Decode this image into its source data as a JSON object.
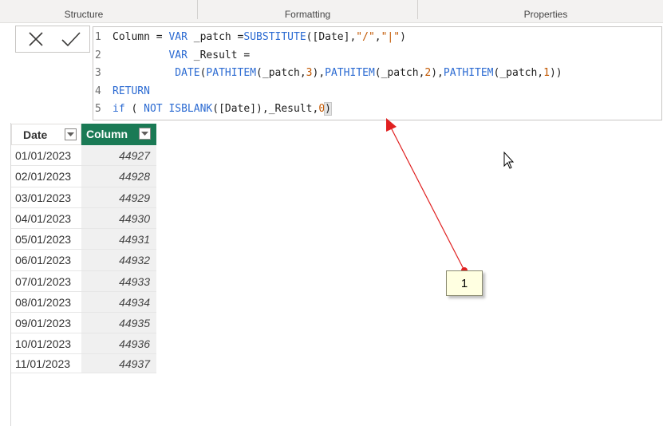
{
  "ribbon": {
    "tabs": [
      {
        "label": "Structure"
      },
      {
        "label": "Formatting"
      },
      {
        "label": "Properties"
      }
    ]
  },
  "formula_bar": {
    "cancel_icon": "close-icon",
    "commit_icon": "checkmark-icon",
    "lines": [
      {
        "num": "1",
        "parts": [
          {
            "t": "Column = ",
            "c": "t"
          },
          {
            "t": "VAR",
            "c": "k"
          },
          {
            "t": " _patch =",
            "c": "t"
          },
          {
            "t": "SUBSTITUTE",
            "c": "k"
          },
          {
            "t": "([Date],",
            "c": "t"
          },
          {
            "t": "\"/\"",
            "c": "s"
          },
          {
            "t": ",",
            "c": "t"
          },
          {
            "t": "\"|\"",
            "c": "s"
          },
          {
            "t": ")",
            "c": "t"
          }
        ]
      },
      {
        "num": "2",
        "parts": [
          {
            "t": "         ",
            "c": "t"
          },
          {
            "t": "VAR",
            "c": "k"
          },
          {
            "t": " _Result =",
            "c": "t"
          }
        ]
      },
      {
        "num": "3",
        "parts": [
          {
            "t": "          ",
            "c": "t"
          },
          {
            "t": "DATE",
            "c": "k"
          },
          {
            "t": "(",
            "c": "t"
          },
          {
            "t": "PATHITEM",
            "c": "k"
          },
          {
            "t": "(_patch,",
            "c": "t"
          },
          {
            "t": "3",
            "c": "s"
          },
          {
            "t": "),",
            "c": "t"
          },
          {
            "t": "PATHITEM",
            "c": "k"
          },
          {
            "t": "(_patch,",
            "c": "t"
          },
          {
            "t": "2",
            "c": "s"
          },
          {
            "t": "),",
            "c": "t"
          },
          {
            "t": "PATHITEM",
            "c": "k"
          },
          {
            "t": "(_patch,",
            "c": "t"
          },
          {
            "t": "1",
            "c": "s"
          },
          {
            "t": "))",
            "c": "t"
          }
        ]
      },
      {
        "num": "4",
        "parts": [
          {
            "t": "RETURN",
            "c": "k"
          }
        ]
      },
      {
        "num": "5",
        "parts": [
          {
            "t": "if",
            "c": "k"
          },
          {
            "t": " ( ",
            "c": "t"
          },
          {
            "t": "NOT",
            "c": "k"
          },
          {
            "t": " ",
            "c": "t"
          },
          {
            "t": "ISBLANK",
            "c": "k"
          },
          {
            "t": "([Date]),_Result,",
            "c": "t"
          },
          {
            "t": "0",
            "c": "s"
          },
          {
            "t": ")",
            "c": "hl"
          }
        ]
      }
    ]
  },
  "table": {
    "columns": [
      {
        "label": "Date"
      },
      {
        "label": "Column"
      }
    ],
    "rows": [
      {
        "date": "01/01/2023",
        "value": "44927"
      },
      {
        "date": "02/01/2023",
        "value": "44928"
      },
      {
        "date": "03/01/2023",
        "value": "44929"
      },
      {
        "date": "04/01/2023",
        "value": "44930"
      },
      {
        "date": "05/01/2023",
        "value": "44931"
      },
      {
        "date": "06/01/2023",
        "value": "44932"
      },
      {
        "date": "07/01/2023",
        "value": "44933"
      },
      {
        "date": "08/01/2023",
        "value": "44934"
      },
      {
        "date": "09/01/2023",
        "value": "44935"
      },
      {
        "date": "10/01/2023",
        "value": "44936"
      },
      {
        "date": "11/01/2023",
        "value": "44937"
      }
    ]
  },
  "callout": {
    "label": "1",
    "arrow_color": "#e02020"
  },
  "colors": {
    "header_green": "#1a7a55",
    "keyword_blue": "#2c6bd2",
    "string_orange": "#c25700"
  }
}
